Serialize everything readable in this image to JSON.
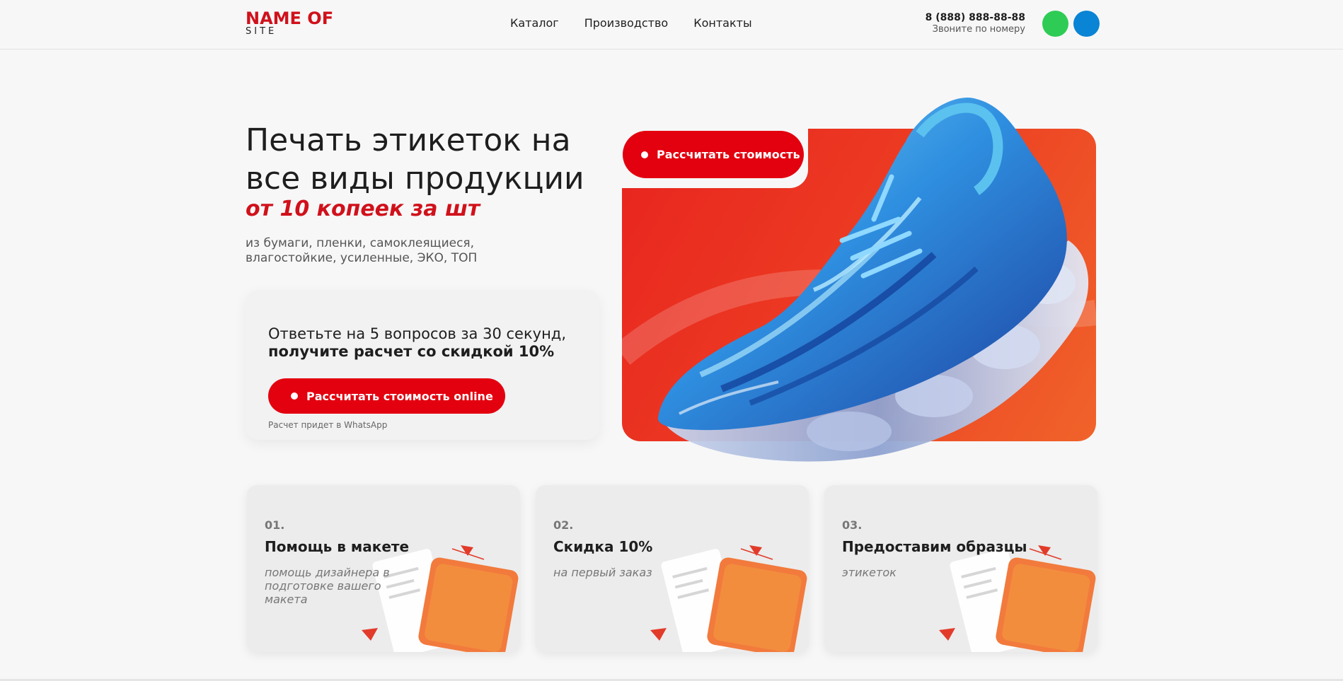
{
  "header": {
    "logo_main": "NAME OF",
    "logo_sub": "SITE",
    "nav": [
      "Каталог",
      "Производство",
      "Контакты"
    ],
    "phone": "8 (888) 888-88-88",
    "phone_note": "Звоните по номеру",
    "messengers": [
      {
        "icon": "whatsapp-icon",
        "color": "#2ecc54"
      },
      {
        "icon": "telegram-icon",
        "color": "#0a84d4"
      }
    ]
  },
  "hero": {
    "title": "Печать этикеток на все виды продукции",
    "subtitle": "от 10 копеек за шт",
    "description": "из бумаги, пленки, самоклеящиеся, влагостойкие, усиленные, ЭКО, ТОП"
  },
  "quiz": {
    "text": "Ответьте на 5 вопросов за 30 секунд,",
    "text_bold": "получите расчет со скидкой 10%",
    "button_label": "Рассчитать стоимость online",
    "note": "Расчет придет в WhatsApp"
  },
  "promo": {
    "button_label": "Рассчитать стоимость",
    "image": "sneaker-image"
  },
  "features": [
    {
      "num": "01.",
      "title": "Помощь в макете",
      "desc": "помощь дизайнера в подготовке вашего макета"
    },
    {
      "num": "02.",
      "title": "Скидка 10%",
      "desc": "на первый заказ"
    },
    {
      "num": "03.",
      "title": "Предоставим образцы",
      "desc": "этикеток"
    }
  ],
  "colors": {
    "accent": "#e3000f",
    "brand": "#d0111b",
    "background": "#f7f7f7"
  }
}
